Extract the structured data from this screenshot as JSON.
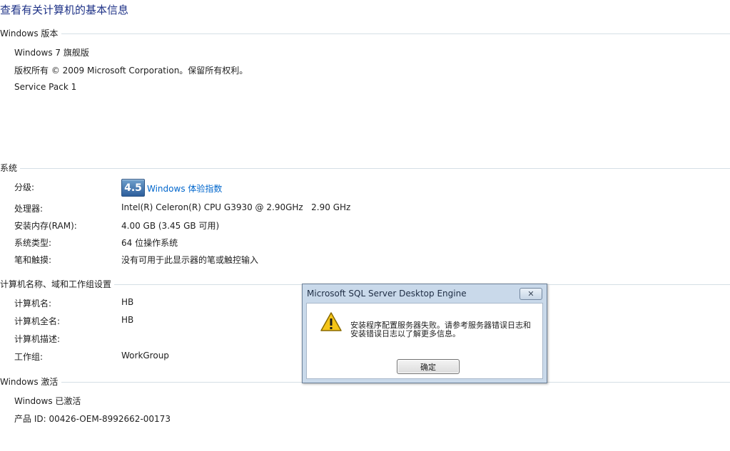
{
  "page_title": "查看有关计算机的基本信息",
  "sections": {
    "edition": {
      "heading": "Windows 版本",
      "name": "Windows 7 旗舰版",
      "copyright": "版权所有 © 2009 Microsoft Corporation。保留所有权利。",
      "service_pack": "Service Pack 1"
    },
    "system": {
      "heading": "系统",
      "rating_label": "分级:",
      "rating_score": "4.5",
      "rating_link": "Windows 体验指数",
      "rows": [
        {
          "label": "处理器:",
          "value": "Intel(R) Celeron(R) CPU G3930 @ 2.90GHz   2.90 GHz"
        },
        {
          "label": "安装内存(RAM):",
          "value": "4.00 GB (3.45 GB 可用)"
        },
        {
          "label": "系统类型:",
          "value": "64 位操作系统"
        },
        {
          "label": "笔和触摸:",
          "value": "没有可用于此显示器的笔或触控输入"
        }
      ]
    },
    "computer": {
      "heading": "计算机名称、域和工作组设置",
      "rows": [
        {
          "label": "计算机名:",
          "value": "HB"
        },
        {
          "label": "计算机全名:",
          "value": "HB"
        },
        {
          "label": "计算机描述:",
          "value": ""
        },
        {
          "label": "工作组:",
          "value": "WorkGroup"
        }
      ]
    },
    "activation": {
      "heading": "Windows 激活",
      "status": "Windows 已激活",
      "product_id": "产品 ID: 00426-OEM-8992662-00173"
    }
  },
  "dialog": {
    "title": "Microsoft SQL Server Desktop Engine",
    "close_glyph": "✕",
    "icon": "warning-icon",
    "message": "安装程序配置服务器失败。请参考服务器错误日志和安装错误日志以了解更多信息。",
    "ok_label": "确定"
  },
  "colors": {
    "title": "#1e3287",
    "link": "#0066cc",
    "dialog_frame": "#c9d9ea",
    "warning": "#f5c518"
  }
}
